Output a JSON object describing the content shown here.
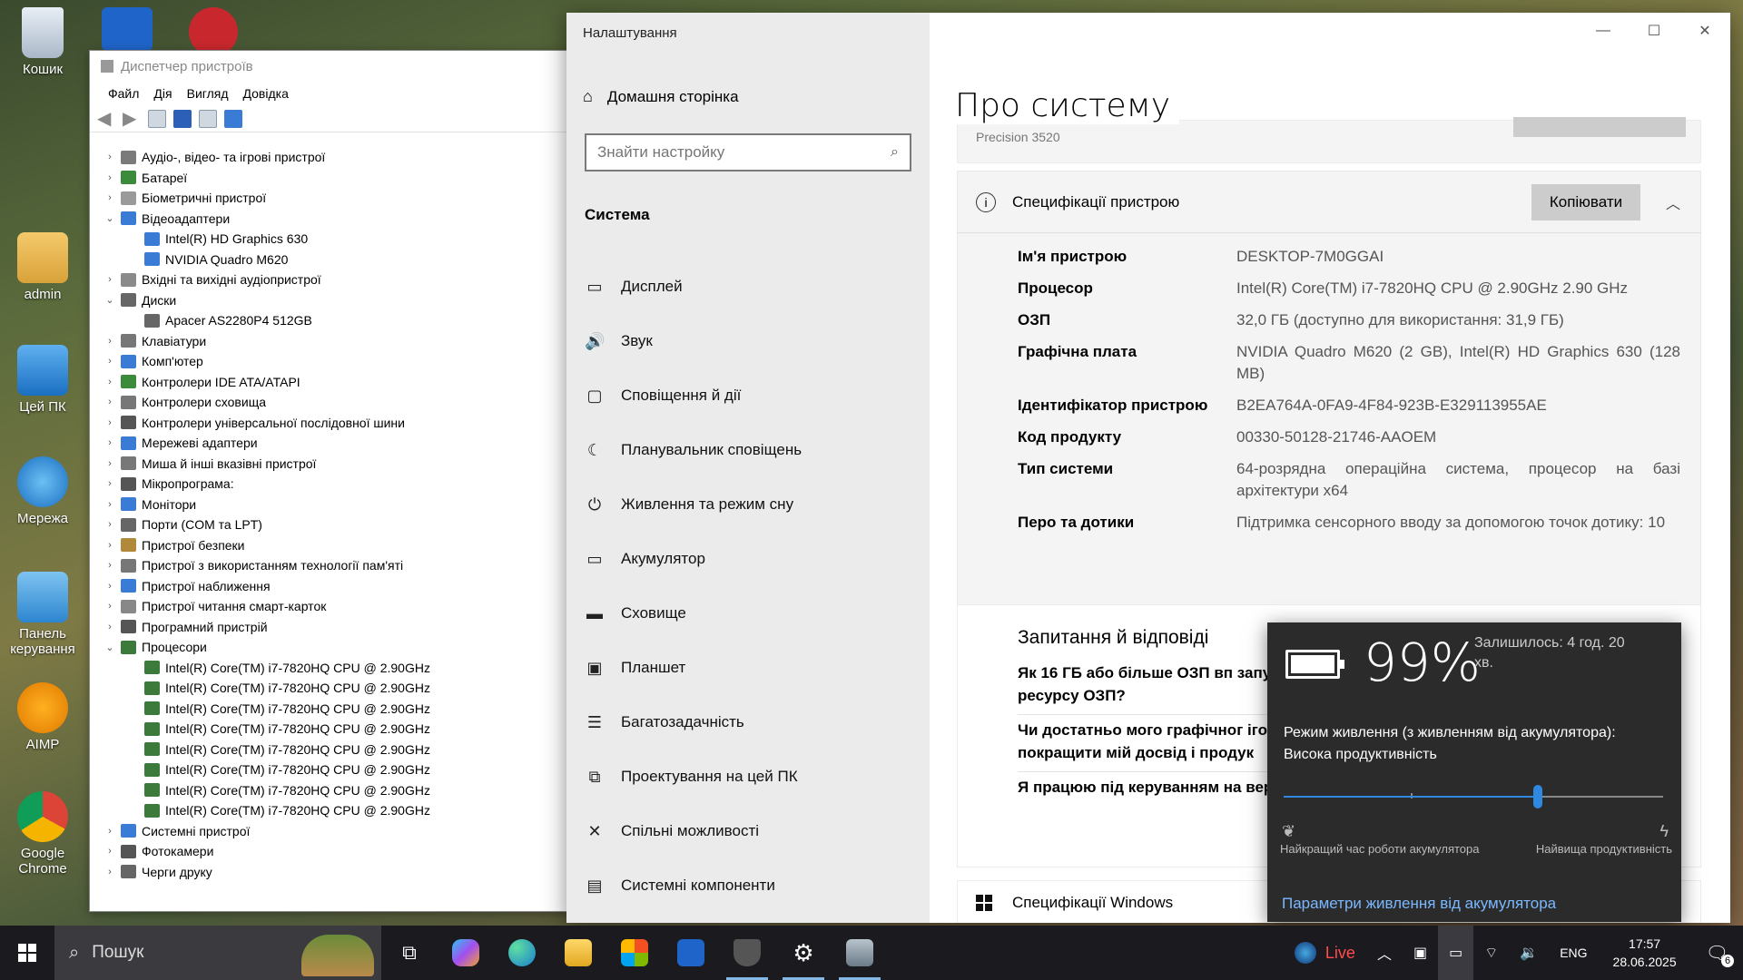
{
  "desktop": {
    "icons": [
      {
        "label": "Кошик"
      },
      {
        "label": "admin"
      },
      {
        "label": "Цей ПК"
      },
      {
        "label": "Мережа"
      },
      {
        "label": "Панель керування"
      },
      {
        "label": "AIMP"
      },
      {
        "label": "Google Chrome"
      }
    ]
  },
  "devmgr": {
    "title": "Диспетчер пристроїв",
    "menu": [
      "Файл",
      "Дія",
      "Вигляд",
      "Довідка"
    ],
    "tree": [
      {
        "label": "Аудіо-, відео- та ігрові пристрої",
        "child": false,
        "arrow": "›",
        "color": "#7a7a7a"
      },
      {
        "label": "Батареї",
        "child": false,
        "arrow": "›",
        "color": "#3c8a3c"
      },
      {
        "label": "Біометричні пристрої",
        "child": false,
        "arrow": "›",
        "color": "#9a9a9a"
      },
      {
        "label": "Відеоадаптери",
        "child": false,
        "arrow": "⌄",
        "color": "#3a7bd5"
      },
      {
        "label": "Intel(R) HD Graphics 630",
        "child": true,
        "arrow": "",
        "color": "#3a7bd5"
      },
      {
        "label": "NVIDIA Quadro M620",
        "child": true,
        "arrow": "",
        "color": "#3a7bd5"
      },
      {
        "label": "Вхідні та вихідні аудіопристрої",
        "child": false,
        "arrow": "›",
        "color": "#8a8a8a"
      },
      {
        "label": "Диски",
        "child": false,
        "arrow": "⌄",
        "color": "#666666"
      },
      {
        "label": "Apacer AS2280P4 512GB",
        "child": true,
        "arrow": "",
        "color": "#666666"
      },
      {
        "label": "Клавіатури",
        "child": false,
        "arrow": "›",
        "color": "#777777"
      },
      {
        "label": "Комп'ютер",
        "child": false,
        "arrow": "›",
        "color": "#3a7bd5"
      },
      {
        "label": "Контролери IDE ATA/ATAPI",
        "child": false,
        "arrow": "›",
        "color": "#3c8a3c"
      },
      {
        "label": "Контролери сховища",
        "child": false,
        "arrow": "›",
        "color": "#777777"
      },
      {
        "label": "Контролери універсальної послідовної шини",
        "child": false,
        "arrow": "›",
        "color": "#555555"
      },
      {
        "label": "Мережеві адаптери",
        "child": false,
        "arrow": "›",
        "color": "#3a7bd5"
      },
      {
        "label": "Миша й інші вказівні пристрої",
        "child": false,
        "arrow": "›",
        "color": "#777777"
      },
      {
        "label": "Мікропрограма:",
        "child": false,
        "arrow": "›",
        "color": "#555555"
      },
      {
        "label": "Монітори",
        "child": false,
        "arrow": "›",
        "color": "#3a7bd5"
      },
      {
        "label": "Порти (COM та LPT)",
        "child": false,
        "arrow": "›",
        "color": "#666666"
      },
      {
        "label": "Пристрої безпеки",
        "child": false,
        "arrow": "›",
        "color": "#b08a3a"
      },
      {
        "label": "Пристрої з використанням технології пам'яті",
        "child": false,
        "arrow": "›",
        "color": "#777777"
      },
      {
        "label": "Пристрої наближення",
        "child": false,
        "arrow": "›",
        "color": "#3a7bd5"
      },
      {
        "label": "Пристрої читання смарт-карток",
        "child": false,
        "arrow": "›",
        "color": "#888888"
      },
      {
        "label": "Програмний пристрій",
        "child": false,
        "arrow": "›",
        "color": "#555555"
      },
      {
        "label": "Процесори",
        "child": false,
        "arrow": "⌄",
        "color": "#3c7a3c"
      },
      {
        "label": "Intel(R) Core(TM) i7-7820HQ CPU @ 2.90GHz",
        "child": true,
        "arrow": "",
        "color": "#3c7a3c"
      },
      {
        "label": "Intel(R) Core(TM) i7-7820HQ CPU @ 2.90GHz",
        "child": true,
        "arrow": "",
        "color": "#3c7a3c"
      },
      {
        "label": "Intel(R) Core(TM) i7-7820HQ CPU @ 2.90GHz",
        "child": true,
        "arrow": "",
        "color": "#3c7a3c"
      },
      {
        "label": "Intel(R) Core(TM) i7-7820HQ CPU @ 2.90GHz",
        "child": true,
        "arrow": "",
        "color": "#3c7a3c"
      },
      {
        "label": "Intel(R) Core(TM) i7-7820HQ CPU @ 2.90GHz",
        "child": true,
        "arrow": "",
        "color": "#3c7a3c"
      },
      {
        "label": "Intel(R) Core(TM) i7-7820HQ CPU @ 2.90GHz",
        "child": true,
        "arrow": "",
        "color": "#3c7a3c"
      },
      {
        "label": "Intel(R) Core(TM) i7-7820HQ CPU @ 2.90GHz",
        "child": true,
        "arrow": "",
        "color": "#3c7a3c"
      },
      {
        "label": "Intel(R) Core(TM) i7-7820HQ CPU @ 2.90GHz",
        "child": true,
        "arrow": "",
        "color": "#3c7a3c"
      },
      {
        "label": "Системні пристрої",
        "child": false,
        "arrow": "›",
        "color": "#3a7bd5"
      },
      {
        "label": "Фотокамери",
        "child": false,
        "arrow": "›",
        "color": "#555555"
      },
      {
        "label": "Черги друку",
        "child": false,
        "arrow": "›",
        "color": "#666666"
      }
    ]
  },
  "settings": {
    "app_title": "Налаштування",
    "home": "Домашня сторінка",
    "search_placeholder": "Знайти настройку",
    "section": "Система",
    "nav_items": [
      {
        "label": "Дисплей",
        "icon": "display-icon",
        "glyph": "▭"
      },
      {
        "label": "Звук",
        "icon": "speaker-icon",
        "glyph": "🔊"
      },
      {
        "label": "Сповіщення й дії",
        "icon": "notification-icon",
        "glyph": "▢"
      },
      {
        "label": "Планувальник сповіщень",
        "icon": "moon-icon",
        "glyph": "☾"
      },
      {
        "label": "Живлення та режим сну",
        "icon": "power-icon",
        "glyph": "⏻"
      },
      {
        "label": "Акумулятор",
        "icon": "battery-icon",
        "glyph": "▭"
      },
      {
        "label": "Сховище",
        "icon": "storage-icon",
        "glyph": "▬"
      },
      {
        "label": "Планшет",
        "icon": "tablet-icon",
        "glyph": "▣"
      },
      {
        "label": "Багатозадачність",
        "icon": "multitask-icon",
        "glyph": "☰"
      },
      {
        "label": "Проектування на цей ПК",
        "icon": "project-icon",
        "glyph": "⧉"
      },
      {
        "label": "Спільні можливості",
        "icon": "share-icon",
        "glyph": "✕"
      },
      {
        "label": "Системні компоненти",
        "icon": "components-icon",
        "glyph": "▤"
      }
    ],
    "page_title": "Про систему",
    "model": "Precision 3520",
    "spec_header": "Специфікації пристрою",
    "copy_button": "Копіювати",
    "specs": [
      {
        "k": "Ім'я пристрою",
        "v": "DESKTOP-7M0GGAI"
      },
      {
        "k": "Процесор",
        "v": "Intel(R) Core(TM) i7-7820HQ CPU @ 2.90GHz   2.90 GHz"
      },
      {
        "k": "ОЗП",
        "v": "32,0 ГБ (доступно для використання: 31,9 ГБ)"
      },
      {
        "k": "Графічна плата",
        "v": "NVIDIA Quadro M620 (2 GB), Intel(R) HD Graphics 630 (128 MB)"
      },
      {
        "k": "Ідентифікатор пристрою",
        "v": "B2EA764A-0FA9-4F84-923B-E329113955AE"
      },
      {
        "k": "Код продукту",
        "v": "00330-50128-21746-AAOEM"
      },
      {
        "k": "Тип системи",
        "v": "64-розрядна операційна система, процесор на базі архітектури x64"
      },
      {
        "k": "Перо та дотики",
        "v": "Підтримка сенсорного вводу за допомогою точок дотику: 10"
      }
    ],
    "qa_title": "Запитання й відповіді",
    "questions": [
      "Як 16 ГБ або більше ОЗП вп запускати сучасні програми ресурсу ОЗП?",
      "Чи достатньо мого графічног ігор і відео? Як наявність виділ покращити мій досвід і продук",
      "Я працюю під керуванням на версія Windows?"
    ],
    "windows_spec": "Специфікації Windows"
  },
  "battery": {
    "percent": "99%",
    "percent_value": 99,
    "remaining": "Залишилось: 4 год. 20 хв.",
    "mode_label": "Режим живлення (з живленням від акумулятора):",
    "mode_value": "Висока продуктивність",
    "slider_value": 0.67,
    "left_label": "Найкращий час роботи акумулятора",
    "right_label": "Найвища продуктивність",
    "link": "Параметри живлення від акумулятора"
  },
  "taskbar": {
    "search": "Пошук",
    "live": "Live",
    "lang": "ENG",
    "time": "17:57",
    "date": "28.06.2025",
    "notifications": "6"
  },
  "colors": {
    "accent": "#2f89e0",
    "link": "#7ab8ff",
    "live": "#ff4d4d"
  }
}
